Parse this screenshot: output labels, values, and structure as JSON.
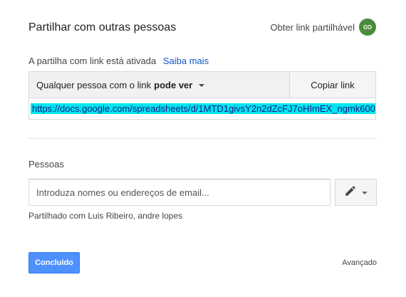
{
  "dialog": {
    "title": "Partilhar com outras pessoas",
    "get_link_label": "Obter link partilhável"
  },
  "link_sharing": {
    "status_text": "A partilha com link está ativada",
    "learn_more": "Saiba mais",
    "access_prefix": "Qualquer pessoa com o link",
    "access_level": "pode ver",
    "copy_button": "Copiar link",
    "url": "https://docs.google.com/spreadsheets/d/1MTD1givsY2n2dZcFJ7oHImEX_ngmk600"
  },
  "people": {
    "label": "Pessoas",
    "input_placeholder": "Introduza nomes ou endereços de email...",
    "input_value": "",
    "shared_with": "Partilhado com Luis Ribeiro, andre lopes"
  },
  "footer": {
    "done_button": "Concluído",
    "advanced_link": "Avançado"
  },
  "icons": {
    "get_link": "link-icon",
    "edit": "pencil-icon",
    "dropdown": "caret-down-icon"
  },
  "colors": {
    "link_circle": "#4b8b3b",
    "primary_button": "#4d90fe",
    "learn_more_link": "#1155cc",
    "url_highlight": "#00e5ee"
  }
}
